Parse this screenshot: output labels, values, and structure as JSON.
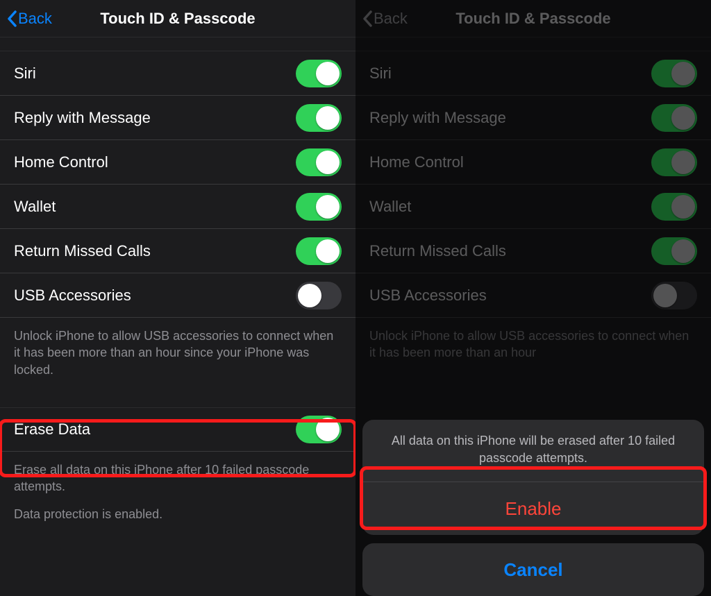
{
  "left": {
    "back": "Back",
    "title": "Touch ID & Passcode",
    "rows": {
      "siri": "Siri",
      "reply": "Reply with Message",
      "home": "Home Control",
      "wallet": "Wallet",
      "missed": "Return Missed Calls",
      "usb": "USB Accessories"
    },
    "usb_footer": "Unlock iPhone to allow USB accessories to connect when it has been more than an hour since your iPhone was locked.",
    "erase": "Erase Data",
    "erase_footer": "Erase all data on this iPhone after 10 failed passcode attempts.",
    "protection": "Data protection is enabled."
  },
  "right": {
    "back": "Back",
    "title": "Touch ID & Passcode",
    "rows": {
      "siri": "Siri",
      "reply": "Reply with Message",
      "home": "Home Control",
      "wallet": "Wallet",
      "missed": "Return Missed Calls",
      "usb": "USB Accessories"
    },
    "usb_footer": "Unlock iPhone to allow USB accessories to connect when it has been more than an hour",
    "sheet_message": "All data on this iPhone will be erased after 10 failed passcode attempts.",
    "sheet_enable": "Enable",
    "sheet_cancel": "Cancel"
  }
}
